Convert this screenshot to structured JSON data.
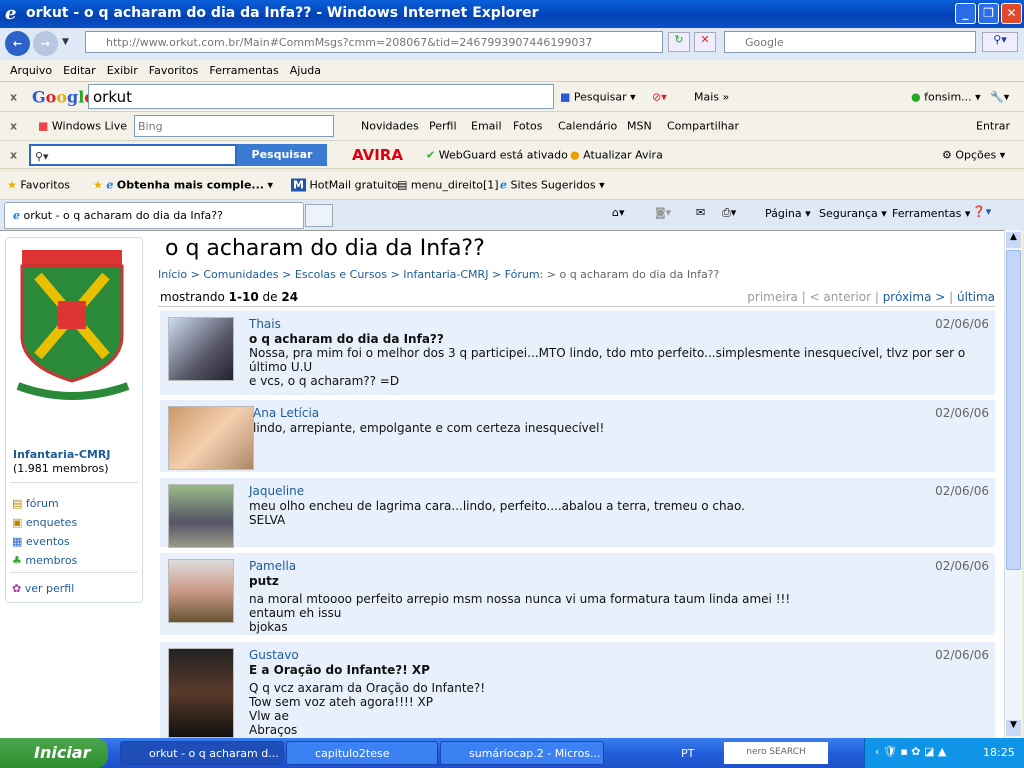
{
  "window": {
    "title": "orkut - o q acharam do dia da Infa?? - Windows Internet Explorer"
  },
  "address": {
    "url": "http://www.orkut.com.br/Main#CommMsgs?cmm=208067&tid=2467993907446199037",
    "search_placeholder": "Google"
  },
  "menu": [
    "Arquivo",
    "Editar",
    "Exibir",
    "Favoritos",
    "Ferramentas",
    "Ajuda"
  ],
  "google_toolbar": {
    "query": "orkut",
    "search": "Pesquisar",
    "more": "Mais »",
    "user": "fonsim..."
  },
  "live_toolbar": {
    "brand": "Windows Live",
    "placeholder": "Bing",
    "links": [
      "Novidades",
      "Perfil",
      "Email",
      "Fotos",
      "Calendário",
      "MSN",
      "Compartilhar"
    ],
    "signin": "Entrar"
  },
  "avira_toolbar": {
    "search": "Pesquisar",
    "brand": "AVIRA",
    "webguard": "WebGuard está ativado",
    "update": "Atualizar Avira",
    "options": "Opções"
  },
  "favorites": {
    "label": "Favoritos",
    "items": [
      "Obtenha mais comple...",
      "HotMail gratuito",
      "menu_direito[1]",
      "Sites Sugeridos"
    ]
  },
  "tab": {
    "title": "orkut - o q acharam do dia da Infa??",
    "commands": [
      "Página",
      "Segurança",
      "Ferramentas"
    ]
  },
  "sidebar": {
    "community": "Infantaria-CMRJ",
    "members": "(1.981 membros)",
    "links": [
      "fórum",
      "enquetes",
      "eventos",
      "membros"
    ],
    "profile": "ver perfil"
  },
  "page": {
    "title": "o q acharam do dia da Infa??",
    "breadcrumb": [
      "Início",
      "Comunidades",
      "Escolas e Cursos",
      "Infantaria-CMRJ",
      "Fórum:",
      "o q acharam do dia da Infa??"
    ],
    "showing": "mostrando",
    "range": "1-10",
    "of": "de",
    "total": "24",
    "pager": [
      "primeira",
      "< anterior",
      "próxima >",
      "última"
    ]
  },
  "posts": [
    {
      "name": "Thais",
      "date": "02/06/06",
      "subject": "o q acharam do dia da Infa??",
      "lines": [
        "Nossa, pra mim foi o melhor dos 3 q participei...MTO lindo, tdo mto perfeito...simplesmente inesquecível, tlvz por ser o último U.U",
        "e vcs, o q acharam?? =D"
      ]
    },
    {
      "name": "Ana Letícia",
      "date": "02/06/06",
      "subject": "",
      "lines": [
        "lindo, arrepiante, empolgante e com certeza inesquecível!"
      ]
    },
    {
      "name": "Jaqueline",
      "date": "02/06/06",
      "subject": "",
      "lines": [
        "meu olho encheu de lagrima cara...lindo, perfeito....abalou a terra, tremeu o chao.",
        "SELVA"
      ]
    },
    {
      "name": "Pamella",
      "date": "02/06/06",
      "subject": "putz",
      "lines": [
        "na moral mtoooo perfeito arrepio msm nossa nunca vi uma formatura taum linda amei !!!",
        "entaum eh issu",
        "bjokas"
      ]
    },
    {
      "name": "Gustavo",
      "date": "02/06/06",
      "subject": "E a Oração do Infante?! XP",
      "lines": [
        "Q q vcz axaram da Oração do Infante?!",
        "Tow sem voz ateh agora!!!! XP",
        "Vlw ae",
        "Abraços"
      ]
    }
  ],
  "taskbar": {
    "start": "Iniciar",
    "tasks": [
      "orkut - o q acharam d...",
      "capitulo2tese",
      "sumáriocap.2 - Micros..."
    ],
    "lang": "PT",
    "nero": "nero SEARCH",
    "clock": "18:25"
  }
}
